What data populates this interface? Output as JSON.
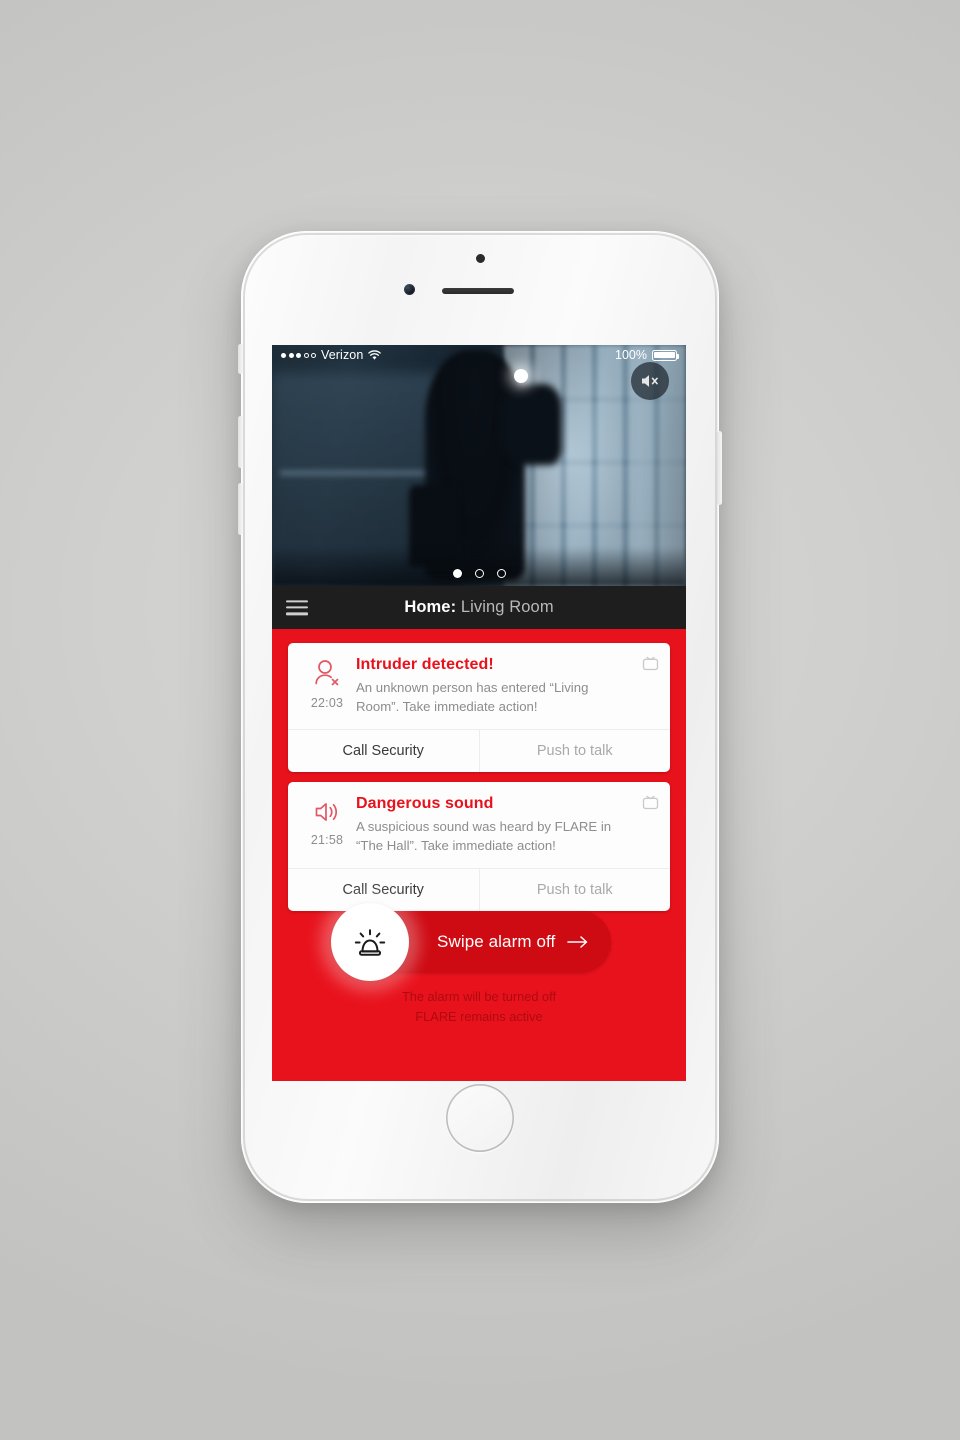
{
  "device": {
    "name": "iphone-white",
    "body_color": "#f5f5f5"
  },
  "status_bar": {
    "signal_dots_filled": 3,
    "signal_dots_total": 5,
    "carrier": "Verizon",
    "wifi_icon": "wifi-icon",
    "battery_percent": "100%"
  },
  "video": {
    "mute_icon": "speaker-mute-icon",
    "page_dots": {
      "total": 3,
      "active_index": 0
    }
  },
  "navbar": {
    "menu_icon": "hamburger-menu-icon",
    "title_bold": "Home:",
    "title_rest": " Living Room"
  },
  "alerts": {
    "background_color": "#E8121C",
    "items": [
      {
        "icon": "person-intruder-icon",
        "time": "22:03",
        "title": "Intruder detected!",
        "text": "An unknown person has entered “Living Room”. Take immediate action!",
        "camera_icon": "tv-camera-icon",
        "actions": [
          {
            "label": "Call Security",
            "style": "primary"
          },
          {
            "label": "Push to talk",
            "style": "secondary"
          }
        ]
      },
      {
        "icon": "speaker-sound-icon",
        "time": "21:58",
        "title": "Dangerous sound",
        "text": "A suspicious sound was heard by FLARE in “The Hall”. Take immediate action!",
        "camera_icon": "tv-camera-icon",
        "actions": [
          {
            "label": "Call Security",
            "style": "primary"
          },
          {
            "label": "Push to talk",
            "style": "secondary"
          }
        ]
      }
    ]
  },
  "swipe": {
    "icon": "siren-alarm-icon",
    "label": "Swipe alarm off",
    "arrow": "arrow-right-icon",
    "track_color": "#CE0A13",
    "footer_line_1": "The alarm will be turned off",
    "footer_line_2": "FLARE remains active"
  }
}
